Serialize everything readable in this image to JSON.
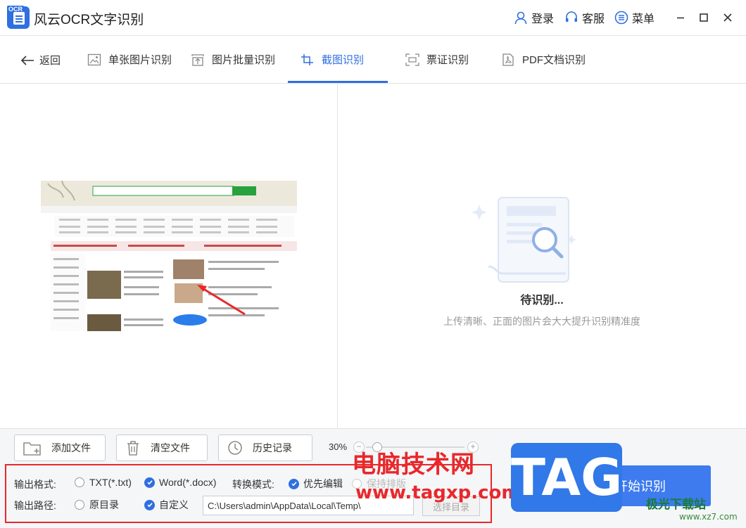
{
  "app": {
    "logo_text": "OCR",
    "title": "风云OCR文字识别"
  },
  "titlebar": {
    "login": "登录",
    "service": "客服",
    "menu": "菜单"
  },
  "nav": {
    "back": "返回",
    "tabs": [
      {
        "label": "单张图片识别"
      },
      {
        "label": "图片批量识别"
      },
      {
        "label": "截图识别"
      },
      {
        "label": "票证识别"
      },
      {
        "label": "PDF文档识别"
      }
    ]
  },
  "right_panel": {
    "status": "待识别...",
    "hint": "上传清晰、正面的图片会大大提升识别精准度"
  },
  "toolbar": {
    "add_file": "添加文件",
    "clear_files": "清空文件",
    "history": "历史记录",
    "zoom": "30%",
    "zoom_minus": "−",
    "zoom_plus": "+"
  },
  "options": {
    "format_label": "输出格式:",
    "format_txt": "TXT(*.txt)",
    "format_word": "Word(*.docx)",
    "mode_label": "转换模式:",
    "mode_edit": "优先编辑",
    "mode_layout": "保持排版",
    "path_label": "输出路径:",
    "path_original": "原目录",
    "path_custom": "自定义",
    "path_value": "C:\\Users\\admin\\AppData\\Local\\Temp\\",
    "choose_dir": "选择目录",
    "start": "开始识别"
  },
  "watermark": {
    "cn": "电脑技术网",
    "url": "www.tagxp.com",
    "tag": "TAG",
    "site": "极光下载站",
    "site_url": "www.xz7.com"
  },
  "colors": {
    "accent": "#2f6fe0",
    "start_button": "#3d7bef",
    "highlight_red": "#e8282b"
  }
}
